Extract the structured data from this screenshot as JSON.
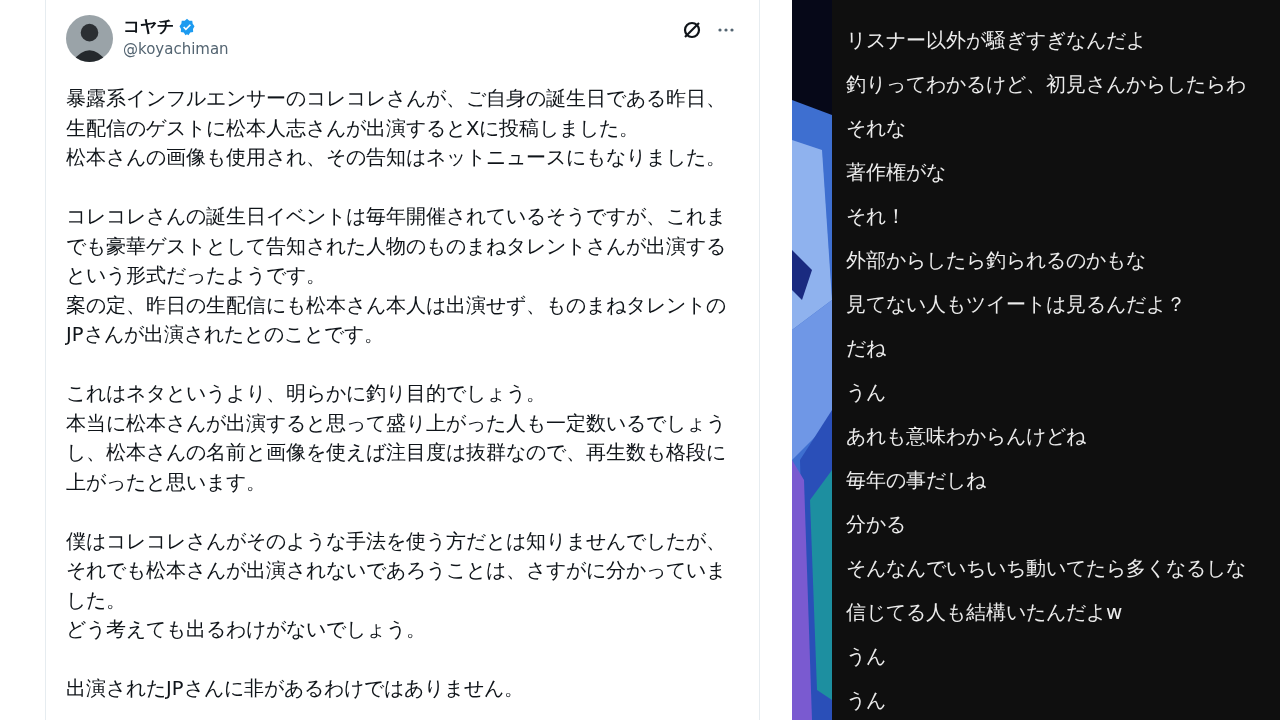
{
  "tweet": {
    "name": "コヤチ",
    "verified": true,
    "handle": "@koyachiman",
    "paragraphs": [
      [
        "暴露系インフルエンサーのコレコレさんが、ご自身の誕生日である昨日、生配信のゲストに松本人志さんが出演するとXに投稿しました。",
        "松本さんの画像も使用され、その告知はネットニュースにもなりました。"
      ],
      [
        "コレコレさんの誕生日イベントは毎年開催されているそうですが、これまでも豪華ゲストとして告知された人物のものまねタレントさんが出演するという形式だったようです。",
        "案の定、昨日の生配信にも松本さん本人は出演せず、ものまねタレントのJPさんが出演されたとのことです。"
      ],
      [
        "これはネタというより、明らかに釣り目的でしょう。",
        "本当に松本さんが出演すると思って盛り上がった人も一定数いるでしょうし、松本さんの名前と画像を使えば注目度は抜群なので、再生数も格段に上がったと思います。"
      ],
      [
        "僕はコレコレさんがそのような手法を使う方だとは知りませんでしたが、それでも松本さんが出演されないであろうことは、さすがに分かっていました。",
        "どう考えても出るわけがないでしょう。"
      ],
      [
        "出演されたJPさんに非があるわけではありません。"
      ]
    ]
  },
  "chat": [
    "リスナー以外が騒ぎすぎなんだよ",
    "釣りってわかるけど、初見さんからしたらわ",
    "それな",
    "著作権がな",
    "それ！",
    "外部からしたら釣られるのかもな",
    "見てない人もツイートは見るんだよ？",
    "だね",
    "うん",
    "あれも意味わからんけどね",
    "毎年の事だしね",
    "分かる",
    "そんなんでいちいち動いてたら多くなるしな",
    "信じてる人も結構いたんだよw",
    "うん",
    "うん"
  ]
}
